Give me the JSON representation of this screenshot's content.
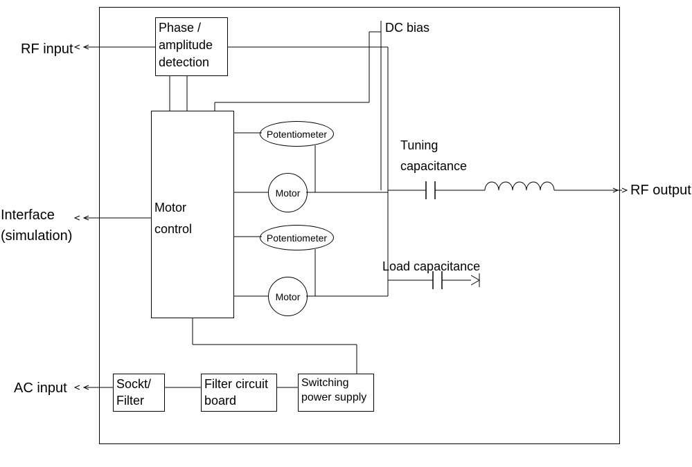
{
  "labels": {
    "rf_input": "RF input",
    "interface": "Interface",
    "simulation": "(simulation)",
    "ac_input": "AC input",
    "rf_output": "RF output",
    "dc_bias": "DC bias",
    "tuning_cap": "Tuning",
    "capacitance": "capacitance",
    "load_cap": "Load capacitance",
    "phase_amp": "Phase /",
    "amplitude": "amplitude",
    "detection": "detection",
    "motor_control": "Motor",
    "control": "control",
    "potentiometer": "Potentiometer",
    "motor": "Motor",
    "socket_filter": "Sockt/",
    "filter": "Filter",
    "filter_circuit": "Filter circuit",
    "board": "board",
    "switching": "Switching",
    "power_supply": "power supply"
  }
}
